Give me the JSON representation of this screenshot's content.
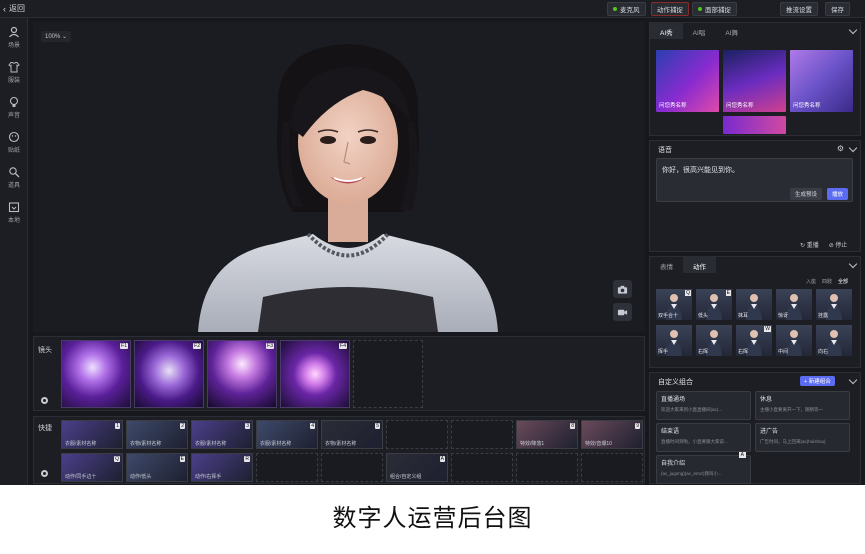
{
  "topbar": {
    "back_label": "返回",
    "mic_label": "麦克风",
    "action_capture_label": "动作捕捉",
    "face_capture_label": "面部捕捉",
    "stream_settings_label": "推流设置",
    "save_label": "保存"
  },
  "sidebar": {
    "items": [
      {
        "label": "场景",
        "icon": "person-icon"
      },
      {
        "label": "服装",
        "icon": "shirt-icon"
      },
      {
        "label": "声音",
        "icon": "voice-icon"
      },
      {
        "label": "贴纸",
        "icon": "sticker-icon"
      },
      {
        "label": "道具",
        "icon": "props-icon"
      },
      {
        "label": "本地",
        "icon": "folder-icon"
      }
    ]
  },
  "stage": {
    "zoom_label": "100%"
  },
  "lens": {
    "label": "镜头",
    "keys": [
      "F1",
      "F2",
      "F3",
      "F4"
    ]
  },
  "quick": {
    "label": "快捷",
    "row1": [
      {
        "label": "衣服/素材名称",
        "key": "1"
      },
      {
        "label": "衣物/素材名称",
        "key": "2"
      },
      {
        "label": "衣服/素材名称",
        "key": "3"
      },
      {
        "label": "衣服/素材名称",
        "key": "4"
      },
      {
        "label": "衣物/素材名称",
        "key": "5"
      },
      {
        "label": "",
        "key": ""
      },
      {
        "label": "",
        "key": ""
      },
      {
        "label": "特效/降落1",
        "key": "8"
      },
      {
        "label": "特效/音爆10",
        "key": "9"
      }
    ],
    "row2": [
      {
        "label": "动作/同手边十",
        "key": "Q"
      },
      {
        "label": "动作/低头",
        "key": "E"
      },
      {
        "label": "动作/右挥手",
        "key": "R"
      },
      {
        "label": "",
        "key": ""
      },
      {
        "label": "",
        "key": ""
      },
      {
        "label": "组合/自定义组",
        "key": "A"
      },
      {
        "label": "",
        "key": ""
      },
      {
        "label": "",
        "key": ""
      },
      {
        "label": "",
        "key": ""
      }
    ]
  },
  "ai_panel": {
    "tabs": [
      "AI秀",
      "AI唱",
      "AI舞"
    ],
    "items": [
      "问您秀名称",
      "问您秀名称",
      "问您秀名称"
    ]
  },
  "voice_panel": {
    "title": "语音",
    "text": "你好，很高兴能见到你。",
    "generate_label": "生成预设",
    "play_label": "播放",
    "replay_label": "重播",
    "stop_label": "停止"
  },
  "action_panel": {
    "tabs": [
      "表情",
      "动作"
    ],
    "filters": [
      "入座",
      "四肢",
      "全部"
    ],
    "items": [
      {
        "label": "双手合十",
        "key": "Q"
      },
      {
        "label": "低头",
        "key": "E"
      },
      {
        "label": "抹耳",
        "key": ""
      },
      {
        "label": "惊讶",
        "key": ""
      },
      {
        "label": "挂露",
        "key": ""
      },
      {
        "label": "挥手",
        "key": ""
      },
      {
        "label": "右挥",
        "key": ""
      },
      {
        "label": "右挥",
        "key": "W"
      },
      {
        "label": "中间",
        "key": ""
      },
      {
        "label": "向右",
        "key": ""
      }
    ]
  },
  "combo_panel": {
    "title": "自定义组合",
    "add_label": "+ 新建组合",
    "items": [
      {
        "title": "直播通场",
        "desc": "欢迎大家来到小直直播间(ac)...",
        "key": ""
      },
      {
        "title": "休息",
        "desc": "主播小直要离开一下，随稍等一",
        "key": ""
      },
      {
        "title": "结束语",
        "desc": "直播时间到啦，小直要跟大家说...",
        "key": ""
      },
      {
        "title": "进广告",
        "desc": "广告时间，马上回来(ac)huishou)",
        "key": ""
      },
      {
        "title": "自我介绍",
        "desc": "(ac_jugong)(ac_error)我叫小...",
        "key": "A"
      }
    ]
  },
  "caption": "数字人运营后台图",
  "colors": {
    "accent": "#5b6cf2",
    "mic_dot": "#52c41a",
    "capture_dot": "#e0493b"
  }
}
